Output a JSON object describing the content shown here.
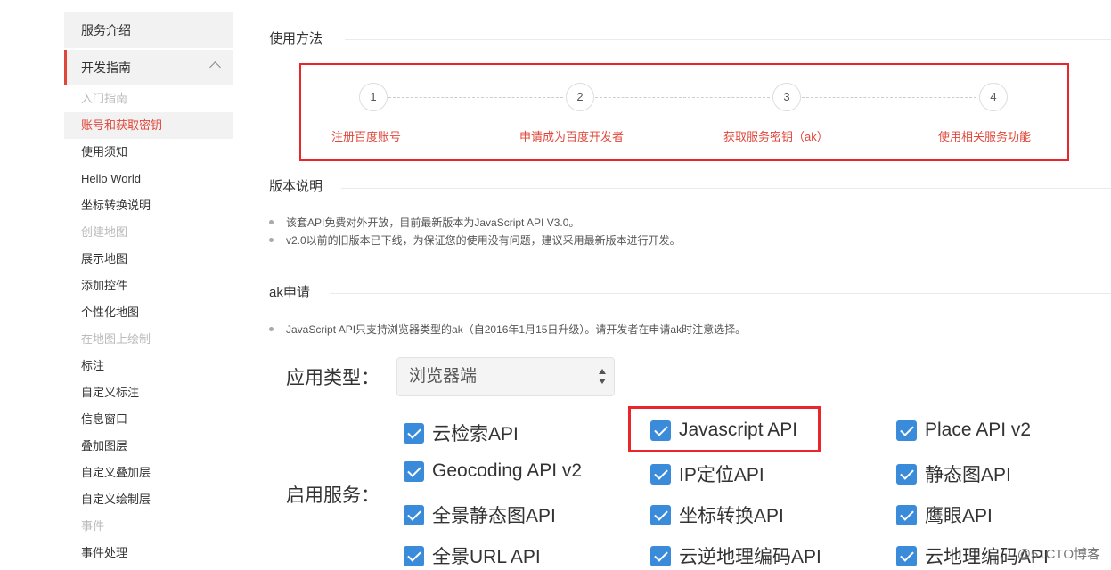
{
  "sidebar": {
    "sections": [
      {
        "label": "服务介绍"
      },
      {
        "label": "开发指南"
      }
    ],
    "items": [
      {
        "label": "入门指南",
        "state": "muted"
      },
      {
        "label": "账号和获取密钥",
        "state": "selected"
      },
      {
        "label": "使用须知",
        "state": "normal"
      },
      {
        "label": "Hello World",
        "state": "normal"
      },
      {
        "label": "坐标转换说明",
        "state": "normal"
      },
      {
        "label": "创建地图",
        "state": "muted"
      },
      {
        "label": "展示地图",
        "state": "normal"
      },
      {
        "label": "添加控件",
        "state": "normal"
      },
      {
        "label": "个性化地图",
        "state": "normal"
      },
      {
        "label": "在地图上绘制",
        "state": "muted"
      },
      {
        "label": "标注",
        "state": "normal"
      },
      {
        "label": "自定义标注",
        "state": "normal"
      },
      {
        "label": "信息窗口",
        "state": "normal"
      },
      {
        "label": "叠加图层",
        "state": "normal"
      },
      {
        "label": "自定义叠加层",
        "state": "normal"
      },
      {
        "label": "自定义绘制层",
        "state": "normal"
      },
      {
        "label": "事件",
        "state": "muted"
      },
      {
        "label": "事件处理",
        "state": "normal"
      }
    ]
  },
  "usage": {
    "title": "使用方法",
    "steps": [
      {
        "num": "1",
        "label": "注册百度账号"
      },
      {
        "num": "2",
        "label": "申请成为百度开发者"
      },
      {
        "num": "3",
        "label": "获取服务密钥（ak）"
      },
      {
        "num": "4",
        "label": "使用相关服务功能"
      }
    ]
  },
  "version": {
    "title": "版本说明",
    "bullets": [
      "该套API免费对外开放，目前最新版本为JavaScript API V3.0。",
      "v2.0以前的旧版本已下线，为保证您的使用没有问题，建议采用最新版本进行开发。"
    ]
  },
  "ak": {
    "title": "ak申请",
    "bullet": "JavaScript API只支持浏览器类型的ak（自2016年1月15日升级）。请开发者在申请ak时注意选择。",
    "app_type_label": "应用类型：",
    "app_type_value": "浏览器端",
    "services_label": "启用服务：",
    "services": [
      [
        "云检索API",
        "Javascript API",
        "Place API v2"
      ],
      [
        "Geocoding API v2",
        "IP定位API",
        "静态图API"
      ],
      [
        "全景静态图API",
        "坐标转换API",
        "鹰眼API"
      ],
      [
        "全景URL API",
        "云逆地理编码API",
        "云地理编码API"
      ]
    ],
    "highlighted_service": "Javascript API"
  },
  "watermark": "@51CTO博客",
  "colors": {
    "accent_red": "#e0473b",
    "highlight_border": "#e8262b",
    "checkbox_blue": "#3b8bdb"
  }
}
